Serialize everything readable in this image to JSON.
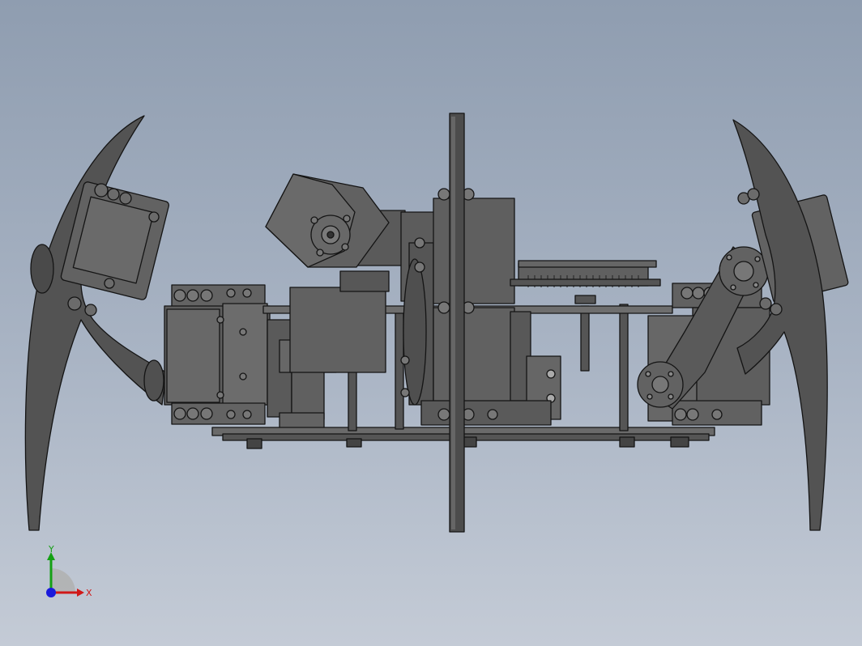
{
  "viewport": {
    "background_top": "#8f9db0",
    "background_bottom": "#c4cbd6",
    "model_fill": "#5b5b5b",
    "model_edge": "#141414"
  },
  "triad": {
    "x_label": "X",
    "y_label": "Y",
    "x_color": "#d01818",
    "y_color": "#14a014",
    "z_color": "#1a1adc"
  }
}
